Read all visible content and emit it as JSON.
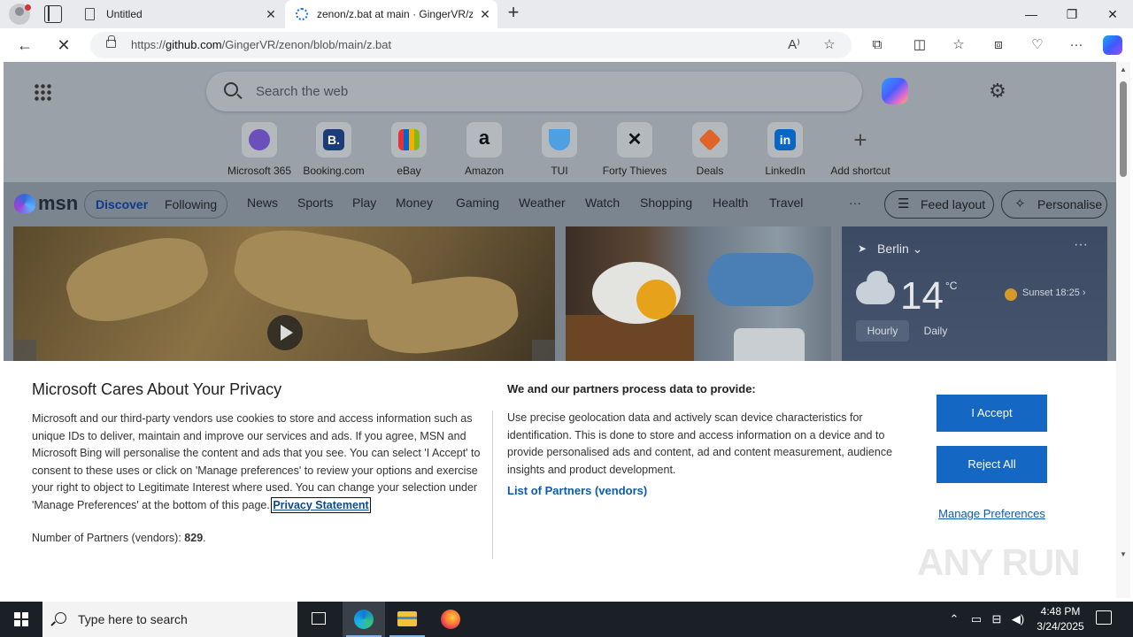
{
  "browser": {
    "tabs": [
      {
        "title": "Untitled"
      },
      {
        "title": "zenon/z.bat at main · GingerVR/z"
      }
    ],
    "address": {
      "prefix": "https://",
      "host": "github.com",
      "path": "/GingerVR/zenon/blob/main/z.bat"
    }
  },
  "msn": {
    "search_placeholder": "Search the web",
    "shortcuts": [
      {
        "label": "Microsoft 365",
        "glyph": "",
        "color": "#6b4fbb"
      },
      {
        "label": "Booking.com",
        "glyph": "B.",
        "color": "#1c3b7a"
      },
      {
        "label": "eBay",
        "glyph": "",
        "color": "#2f8fd8"
      },
      {
        "label": "Amazon",
        "glyph": "a",
        "color": "#222222"
      },
      {
        "label": "TUI",
        "glyph": "",
        "color": "#4fa0e0"
      },
      {
        "label": "Forty Thieves",
        "glyph": "✕",
        "color": "#222222"
      },
      {
        "label": "Deals",
        "glyph": "",
        "color": "#e0642a"
      },
      {
        "label": "LinkedIn",
        "glyph": "in",
        "color": "#0a66c2"
      },
      {
        "label": "Add shortcut",
        "glyph": "+",
        "color": "#555555"
      }
    ],
    "logo_text": "msn",
    "pill_discover": "Discover",
    "pill_following": "Following",
    "nav": [
      "News",
      "Sports",
      "Play",
      "Money",
      "Gaming",
      "Weather",
      "Watch",
      "Shopping",
      "Health",
      "Travel"
    ],
    "more": "···",
    "feed_layout": "Feed layout",
    "personalise": "Personalise",
    "weather": {
      "location": "Berlin",
      "temp": "14",
      "unit": "°C",
      "sunset": "Sunset 18:25",
      "tab_hourly": "Hourly",
      "tab_daily": "Daily"
    }
  },
  "consent": {
    "title": "Microsoft Cares About Your Privacy",
    "body": "Microsoft and our third-party vendors use cookies to store and access information such as unique IDs to deliver, maintain and improve our services and ads. If you agree, MSN and Microsoft Bing will personalise the content and ads that you see. You can select 'I Accept' to consent to these uses or click on 'Manage preferences' to review your options and exercise your right to object to Legitimate Interest where used.  You can change your selection under 'Manage Preferences' at the bottom of this page.",
    "privacy_link": "Privacy Statement",
    "partners_label": "Number of Partners (vendors):",
    "partners_count": "829",
    "heading2": "We and our partners process data to provide:",
    "body2": "Use precise geolocation data and actively scan device characteristics for identification. This is done to store and access information on a device and to provide personalised ads and content, ad and content measurement, audience insights and product development.",
    "partners_list": "List of Partners (vendors)",
    "accept": "I Accept",
    "reject": "Reject All",
    "manage": "Manage Preferences"
  },
  "watermark": "ANY RUN",
  "taskbar": {
    "search_placeholder": "Type here to search",
    "time": "4:48 PM",
    "date": "3/24/2025"
  }
}
